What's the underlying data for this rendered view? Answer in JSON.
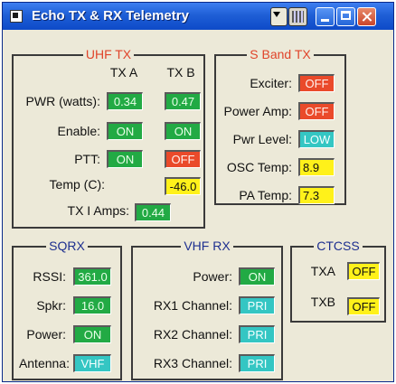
{
  "window": {
    "title": "Echo TX & RX Telemetry"
  },
  "uhf_tx": {
    "title": "UHF TX",
    "col_a": "TX A",
    "col_b": "TX B",
    "rows": {
      "pwr": {
        "label": "PWR (watts):",
        "a": "0.34",
        "b": "0.47"
      },
      "enable": {
        "label": "Enable:",
        "a": "ON",
        "b": "ON"
      },
      "ptt": {
        "label": "PTT:",
        "a": "ON",
        "b": "OFF"
      },
      "temp": {
        "label": "Temp (C):",
        "b": "-46.0"
      },
      "txi": {
        "label": "TX I Amps:",
        "value": "0.44"
      }
    }
  },
  "s_band_tx": {
    "title": "S Band TX",
    "rows": {
      "exciter": {
        "label": "Exciter:",
        "value": "OFF"
      },
      "power_amp": {
        "label": "Power Amp:",
        "value": "OFF"
      },
      "pwr_level": {
        "label": "Pwr Level:",
        "value": "LOW"
      },
      "osc_temp": {
        "label": "OSC Temp:",
        "value": "8.9"
      },
      "pa_temp": {
        "label": "PA Temp:",
        "value": "7.3"
      }
    }
  },
  "sqrx": {
    "title": "SQRX",
    "rows": {
      "rssi": {
        "label": "RSSI:",
        "value": "361.0"
      },
      "spkr": {
        "label": "Spkr:",
        "value": "16.0"
      },
      "power": {
        "label": "Power:",
        "value": "ON"
      },
      "antenna": {
        "label": "Antenna:",
        "value": "VHF"
      }
    }
  },
  "vhf_rx": {
    "title": "VHF RX",
    "rows": {
      "power": {
        "label": "Power:",
        "value": "ON"
      },
      "rx1": {
        "label": "RX1 Channel:",
        "value": "PRI"
      },
      "rx2": {
        "label": "RX2 Channel:",
        "value": "PRI"
      },
      "rx3": {
        "label": "RX3 Channel:",
        "value": "PRI"
      }
    }
  },
  "ctcss": {
    "title": "CTCSS",
    "rows": {
      "txa": {
        "label": "TXA",
        "value": "OFF"
      },
      "txb": {
        "label": "TXB",
        "value": "OFF"
      }
    }
  },
  "colors": {
    "on_green": "#22aa44",
    "off_red": "#ea4a2a",
    "value_yellow": "#fff11a",
    "state_cyan": "#34c6c3",
    "title_red": "#e0442a",
    "title_blue": "#1d2f8f",
    "window_bg": "#ece9d8",
    "titlebar_blue": "#1f5fd6"
  },
  "icons": {
    "app": "app-icon",
    "menu": "dropdown-arrow-icon",
    "calc": "calculator-icon",
    "minimize": "minimize-icon",
    "maximize": "maximize-icon",
    "close": "close-icon"
  }
}
